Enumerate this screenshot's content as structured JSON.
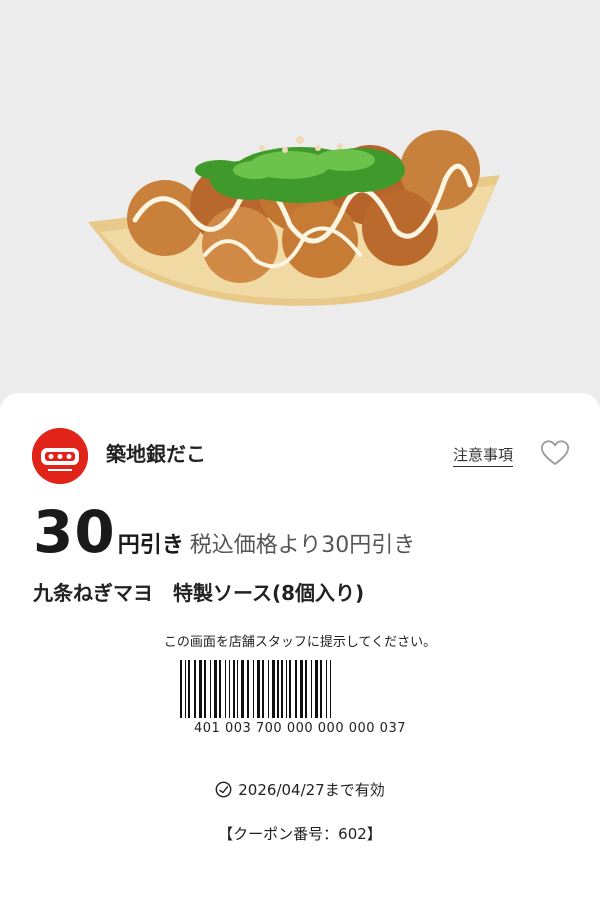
{
  "brand": {
    "logo_icon": "gindaco-logo-icon",
    "logo_color": "#e2231a",
    "name": "築地銀だこ"
  },
  "header": {
    "notes_label": "注意事項",
    "favorite_icon": "heart-outline-icon"
  },
  "offer": {
    "amount": "30",
    "unit": "円引き",
    "note": "税込価格より30円引き",
    "product_name": "九条ねぎマヨ　特製ソース(8個入り)"
  },
  "redeem": {
    "instruction": "この画面を店舗スタッフに提示してください。",
    "barcode_number": "401 003 700 000 000 000 037"
  },
  "validity": {
    "icon": "clock-icon",
    "text": "2026/04/27まで有効"
  },
  "coupon": {
    "number_text": "【クーポン番号：602】"
  }
}
